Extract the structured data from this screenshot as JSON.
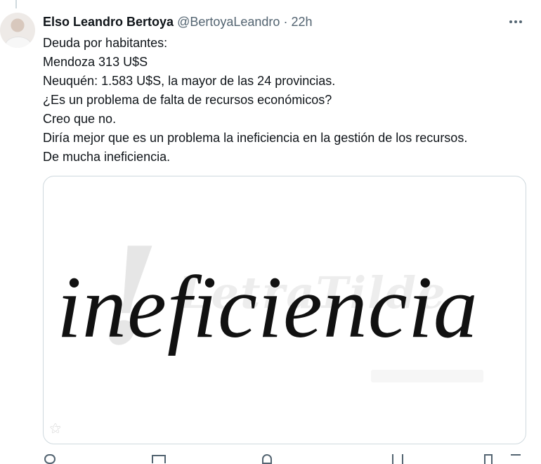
{
  "tweet": {
    "author_name": "Elso Leandro Bertoya",
    "handle": "@BertoyaLeandro",
    "separator": "·",
    "time": "22h",
    "text_lines": [
      "Deuda por habitantes:",
      "Mendoza 313 U$S",
      "Neuquén: 1.583 U$S, la mayor de las 24 provincias.",
      "¿Es un problema de falta de recursos económicos?",
      "Creo que no.",
      "Diría mejor que es un problema la ineficiencia en la gestión de los recursos.",
      "De mucha ineficiencia."
    ],
    "media": {
      "word": "ineficiencia",
      "watermark": "LetraTilde"
    }
  },
  "icons": {
    "more": "more-horizontal-icon",
    "reply": "reply-icon",
    "retweet": "retweet-icon",
    "like": "heart-icon",
    "views": "views-icon",
    "bookmark": "bookmark-icon",
    "share": "share-icon"
  },
  "colors": {
    "text": "#0f1419",
    "secondary": "#536471",
    "border": "#cfd9de"
  }
}
